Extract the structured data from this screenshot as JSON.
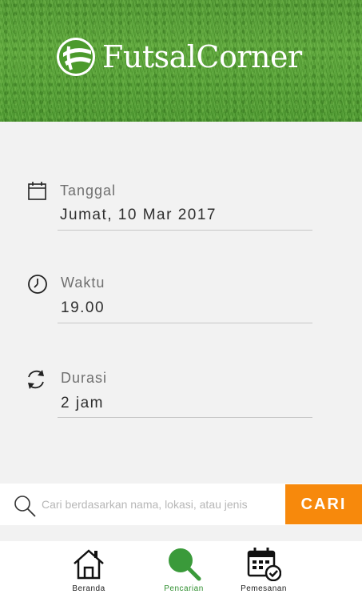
{
  "header": {
    "brand_name": "FutsalCorner",
    "logo_icon": "futsal-ball-logo-icon"
  },
  "form": {
    "date": {
      "icon": "calendar-icon",
      "label": "Tanggal",
      "value": "Jumat, 10 Mar 2017"
    },
    "time": {
      "icon": "clock-icon",
      "label": "Waktu",
      "value": "19.00"
    },
    "duration": {
      "icon": "refresh-cycle-icon",
      "label": "Durasi",
      "value": "2 jam"
    }
  },
  "search": {
    "placeholder": "Cari berdasarkan nama, lokasi, atau jenis",
    "value": "",
    "button_label": "CARI"
  },
  "nav": {
    "items": [
      {
        "label": "Beranda",
        "icon": "home-icon",
        "active": false
      },
      {
        "label": "Pencarian",
        "icon": "search-icon",
        "active": true
      },
      {
        "label": "Pemesanan",
        "icon": "calendar-check-icon",
        "active": false
      }
    ]
  },
  "colors": {
    "accent_orange": "#f7890c",
    "active_green": "#3a9a3a",
    "header_green": "#56a532",
    "background": "#f2f2f2"
  }
}
